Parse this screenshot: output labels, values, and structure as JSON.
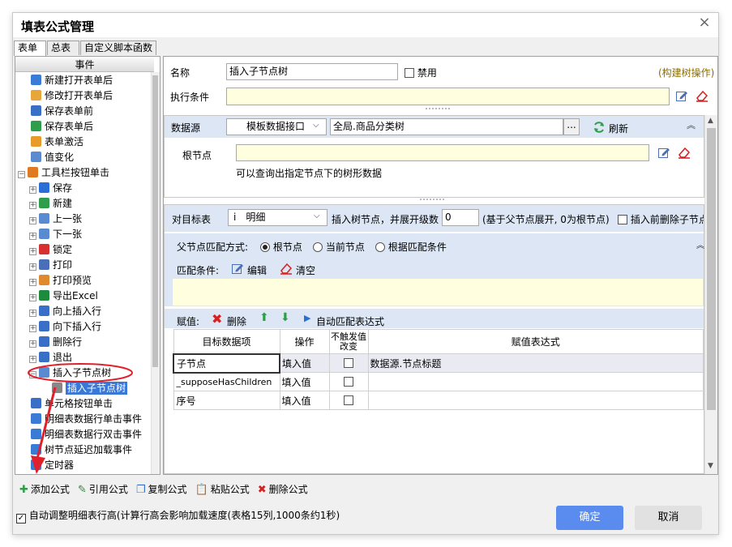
{
  "window": {
    "title": "填表公式管理",
    "close": "×"
  },
  "tabs": [
    "表单",
    "总表",
    "自定义脚本函数"
  ],
  "tree": {
    "header": "事件",
    "items": [
      {
        "label": "新建打开表单后",
        "icon": "person-add-icon",
        "color": "#3a7bd5",
        "level": 1
      },
      {
        "label": "修改打开表单后",
        "icon": "folder-edit-icon",
        "color": "#e8a53a",
        "level": 1
      },
      {
        "label": "保存表单前",
        "icon": "save-doc-icon",
        "color": "#3a6fc8",
        "level": 1
      },
      {
        "label": "保存表单后",
        "icon": "save-check-icon",
        "color": "#2e9e4a",
        "level": 1
      },
      {
        "label": "表单激活",
        "icon": "form-activate-icon",
        "color": "#e89a2a",
        "level": 1
      },
      {
        "label": "值变化",
        "icon": "value-change-icon",
        "color": "#5a8ad0",
        "level": 1
      },
      {
        "label": "工具栏按钮单击",
        "icon": "tools-icon",
        "color": "#e07a20",
        "level": 1,
        "toggle": "−"
      },
      {
        "label": "保存",
        "icon": "save-icon",
        "color": "#2a6fd8",
        "level": 2,
        "toggle": "+"
      },
      {
        "label": "新建",
        "icon": "new-icon",
        "color": "#2e9e4a",
        "level": 2,
        "toggle": "+"
      },
      {
        "label": "上一张",
        "icon": "prev-icon",
        "color": "#5a8ad0",
        "level": 2,
        "toggle": "+"
      },
      {
        "label": "下一张",
        "icon": "next-icon",
        "color": "#5a8ad0",
        "level": 2,
        "toggle": "+"
      },
      {
        "label": "锁定",
        "icon": "lock-icon",
        "color": "#d83030",
        "level": 2,
        "toggle": "+"
      },
      {
        "label": "打印",
        "icon": "print-icon",
        "color": "#4a6fb8",
        "level": 2,
        "toggle": "+"
      },
      {
        "label": "打印预览",
        "icon": "print-preview-icon",
        "color": "#e08a30",
        "level": 2,
        "toggle": "+"
      },
      {
        "label": "导出Excel",
        "icon": "excel-icon",
        "color": "#1e8a3e",
        "level": 2,
        "toggle": "+"
      },
      {
        "label": "向上插入行",
        "icon": "insert-up-icon",
        "color": "#3a6fc8",
        "level": 2,
        "toggle": "+"
      },
      {
        "label": "向下插入行",
        "icon": "insert-down-icon",
        "color": "#3a6fc8",
        "level": 2,
        "toggle": "+"
      },
      {
        "label": "删除行",
        "icon": "delete-row-icon",
        "color": "#3a6fc8",
        "level": 2,
        "toggle": "+"
      },
      {
        "label": "退出",
        "icon": "power-icon",
        "color": "#3a6fc8",
        "level": 2,
        "toggle": "+"
      },
      {
        "label": "插入子节点树",
        "icon": "tree-insert-icon",
        "color": "#5a8ad0",
        "level": 2,
        "toggle": "−",
        "circled": true
      },
      {
        "label": "插入子节点树",
        "icon": "formula-icon",
        "color": "#888",
        "level": 3,
        "selected": true
      },
      {
        "label": "单元格按钮单击",
        "icon": "cell-button-icon",
        "color": "#3a6fc8",
        "level": 1
      },
      {
        "label": "明细表数据行单击事件",
        "icon": "row-click-icon",
        "color": "#3a7bd5",
        "level": 1
      },
      {
        "label": "明细表数据行双击事件",
        "icon": "row-dblclick-icon",
        "color": "#3a7bd5",
        "level": 1
      },
      {
        "label": "树节点延迟加载事件",
        "icon": "tree-lazy-icon",
        "color": "#3a7bd5",
        "level": 1
      },
      {
        "label": "定时器",
        "icon": "timer-icon",
        "color": "#3a7bd5",
        "level": 1
      }
    ]
  },
  "form": {
    "name_label": "名称",
    "name_value": "插入子节点树",
    "disable_label": "禁用",
    "build_tree_link": "(构建树操作)",
    "exec_cond_label": "执行条件",
    "datasource_label": "数据源",
    "datasource_type": "模板数据接口",
    "datasource_value": "全局.商品分类树",
    "ellipsis": "...",
    "refresh_label": "刷新",
    "rootnode_label": "根节点",
    "rootnode_hint": "可以查询出指定节点下的树形数据",
    "target_label": "对目标表",
    "target_prefix": "i",
    "target_value": "明细",
    "insert_label": "插入树节点，并展开级数",
    "expand_level": "0",
    "expand_hint": "(基于父节点展开, 0为根节点)",
    "delete_before_label": "插入前删除子节点",
    "parent_match_label": "父节点匹配方式:",
    "radio_root": "根节点",
    "radio_current": "当前节点",
    "radio_cond": "根据匹配条件",
    "match_cond_label": "匹配条件:",
    "edit_label": "编辑",
    "clear_label": "清空",
    "assign_label": "赋值:",
    "delete_label": "删除",
    "auto_match_label": "自动匹配表达式"
  },
  "table": {
    "headers": [
      "目标数据项",
      "操作",
      "不触发值改变",
      "赋值表达式"
    ],
    "rows": [
      {
        "target": "子节点",
        "op": "填入值",
        "expr": "数据源.节点标题"
      },
      {
        "target": "_supposeHasChildren",
        "op": "填入值",
        "expr": ""
      },
      {
        "target": "序号",
        "op": "填入值",
        "expr": ""
      }
    ]
  },
  "bottom_toolbar": [
    "添加公式",
    "引用公式",
    "复制公式",
    "粘贴公式",
    "删除公式"
  ],
  "footer": {
    "auto_adjust_label": "自动调整明细表行高(计算行高会影响加载速度(表格15列,1000条约1秒)",
    "ok": "确定",
    "cancel": "取消"
  },
  "colors": {
    "accent": "#5a8cf0",
    "yellow": "#ffffe0",
    "band": "#dce6f4",
    "link": "#8a6d00",
    "annot": "#e0202a"
  }
}
